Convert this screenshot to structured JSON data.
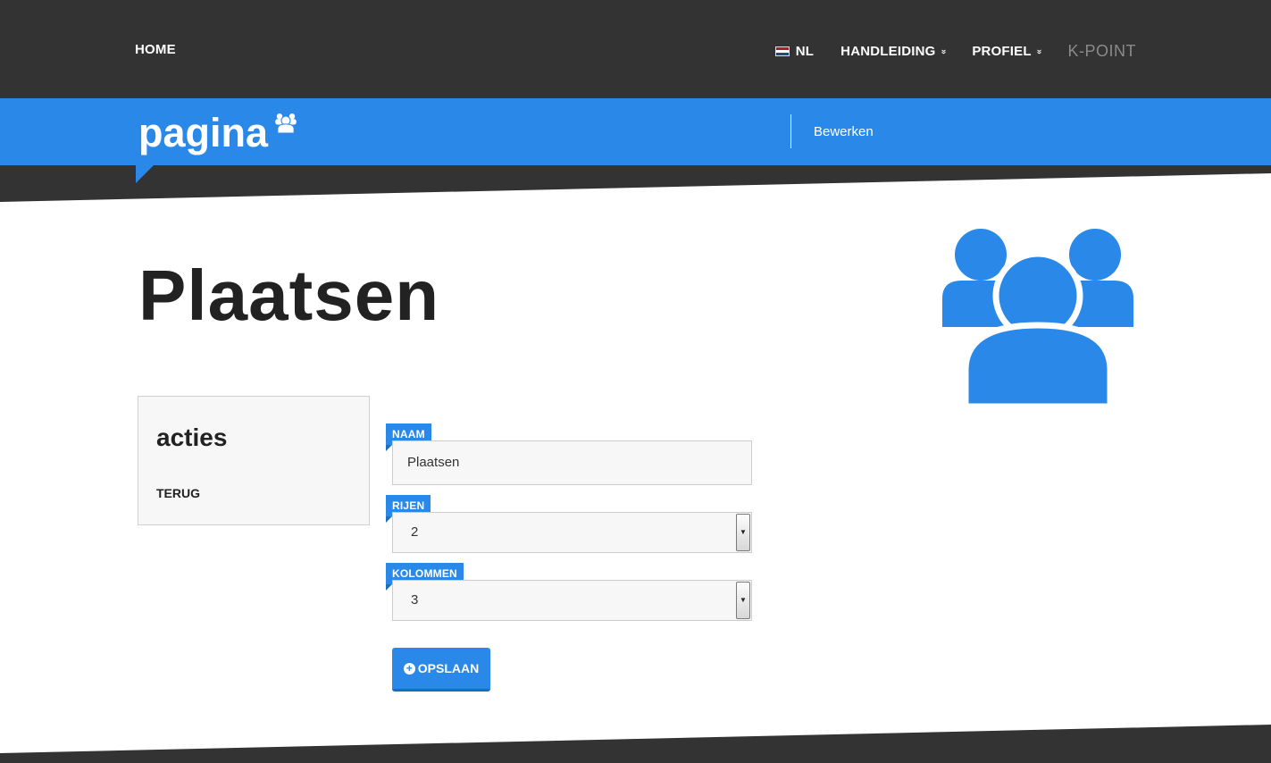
{
  "nav": {
    "home": "HOME",
    "language": "NL",
    "manual": "HANDLEIDING",
    "profile": "PROFIEL",
    "brand": "K-POINT",
    "caret": "»"
  },
  "header": {
    "section_title": "pagina",
    "edit_link": "Bewerken"
  },
  "page": {
    "title": "Plaatsen"
  },
  "actions": {
    "title": "acties",
    "back": "TERUG"
  },
  "form": {
    "name_label": "NAAM",
    "name_value": "Plaatsen",
    "rows_label": "RIJEN",
    "rows_value": "2",
    "columns_label": "KOLOMMEN",
    "columns_value": "3",
    "save_label": "OPSLAAN"
  },
  "colors": {
    "accent": "#2a89e8",
    "dark": "#333333"
  },
  "icons": {
    "header": "users-icon",
    "hero": "users-icon",
    "save": "plus-circle-icon",
    "flag": "flag-nl-icon"
  }
}
